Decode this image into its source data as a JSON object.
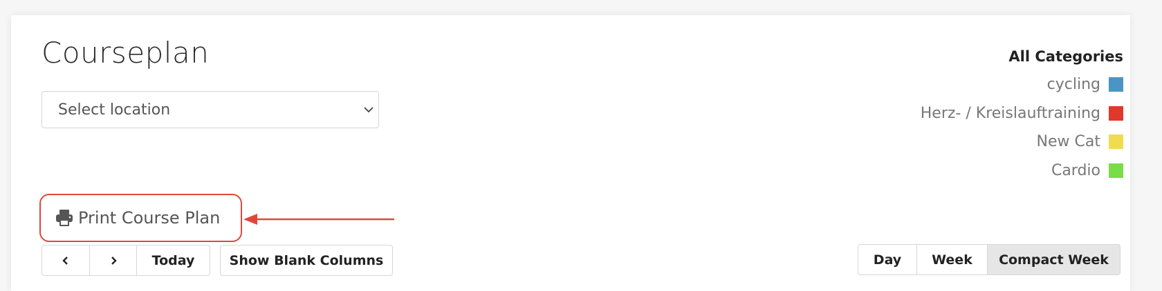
{
  "page": {
    "title": "Courseplan"
  },
  "location_select": {
    "placeholder": "Select location",
    "icon": "chevron-down-icon"
  },
  "legend": {
    "title": "All Categories",
    "items": [
      {
        "label": "cycling",
        "color": "#4a95c4"
      },
      {
        "label": "Herz- / Kreislauftraining",
        "color": "#e0382a"
      },
      {
        "label": "New Cat",
        "color": "#f1db4e"
      },
      {
        "label": "Cardio",
        "color": "#78dd46"
      }
    ]
  },
  "print": {
    "label": "Print Course Plan",
    "icon": "printer-icon",
    "highlight_color": "#e0473a"
  },
  "toolbar": {
    "prev_icon": "chevron-left-icon",
    "next_icon": "chevron-right-icon",
    "today_label": "Today",
    "blank_columns_label": "Show Blank Columns"
  },
  "views": {
    "day_label": "Day",
    "week_label": "Week",
    "compact_week_label": "Compact Week",
    "active": "Compact Week"
  }
}
